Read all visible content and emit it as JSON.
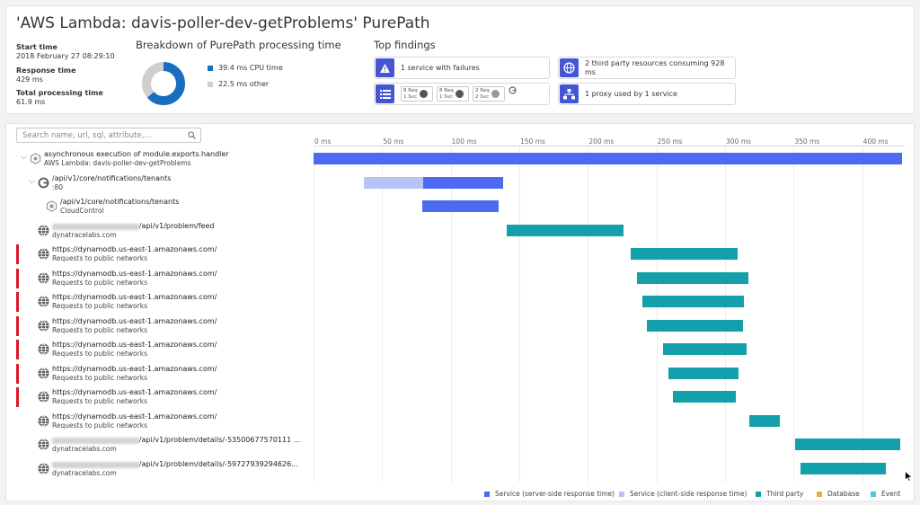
{
  "title": "'AWS Lambda: davis-poller-dev-getProblems' PurePath",
  "summary": [
    {
      "key": "Start time",
      "value": "2018 February 27 08:29:10"
    },
    {
      "key": "Response time",
      "value": "429 ms"
    },
    {
      "key": "Total processing time",
      "value": "61.9 ms"
    }
  ],
  "breakdown": {
    "title": "Breakdown of PurePath processing time",
    "items": [
      {
        "label": "39.4 ms CPU time",
        "color": "#1a6dbf",
        "value": 39.4
      },
      {
        "label": "22.5 ms other",
        "color": "#cfcfcf",
        "value": 22.5
      }
    ]
  },
  "findings": {
    "title": "Top findings",
    "items": [
      {
        "text": "1 service with failures",
        "icon": "warning-icon"
      },
      {
        "text": "2 third party resources consuming 928 ms",
        "icon": "globe-icon"
      },
      {
        "text": "1 proxy used by 1 service",
        "icon": "proxy-icon"
      }
    ],
    "chips": [
      {
        "l1": "8 Req",
        "l2": "1 Svc"
      },
      {
        "l1": "8 Req",
        "l2": "1 Svc"
      },
      {
        "l1": "2 Req",
        "l2": "2 Svc"
      }
    ]
  },
  "search": {
    "placeholder": "Search name, url, sql, attribute,..."
  },
  "axis": {
    "ticks": [
      "0 ms",
      "50 ms",
      "100 ms",
      "150 ms",
      "200 ms",
      "250 ms",
      "300 ms",
      "350 ms",
      "400 ms"
    ],
    "max_ms": 431
  },
  "rows": [
    {
      "l1": "asynchronous execution of module.exports.handler",
      "l2": "AWS Lambda: davis-poller-dev-getProblems",
      "indent": 0,
      "icon": "lambda-icon",
      "expand": true,
      "failed": false,
      "bar": {
        "start": 0,
        "end": 429,
        "kind": "server"
      }
    },
    {
      "l1": "/api/v1/core/notifications/tenants",
      "l2": ":80",
      "indent": 1,
      "icon": "proxy-g-icon",
      "expand": true,
      "failed": false,
      "bar": {
        "start": 37,
        "end": 138,
        "kind": "mixed",
        "split": 80
      }
    },
    {
      "l1": "/api/v1/core/notifications/tenants",
      "l2": "CloudControl",
      "indent": 2,
      "icon": "service-icon",
      "expand": false,
      "failed": false,
      "bar": {
        "start": 79,
        "end": 135,
        "kind": "server"
      }
    },
    {
      "l1pre": "https://davis.dev.dynatrace.com",
      "l1": "/api/v1/problem/feed",
      "l2": "dynatracelabs.com",
      "indent": 1,
      "icon": "globe-icon",
      "expand": false,
      "failed": false,
      "bar": {
        "start": 141,
        "end": 226,
        "kind": "third"
      }
    },
    {
      "l1": "https://dynamodb.us-east-1.amazonaws.com/",
      "l2": "Requests to public networks",
      "indent": 1,
      "icon": "globe-icon",
      "expand": false,
      "failed": true,
      "bar": {
        "start": 231,
        "end": 309,
        "kind": "third"
      }
    },
    {
      "l1": "https://dynamodb.us-east-1.amazonaws.com/",
      "l2": "Requests to public networks",
      "indent": 1,
      "icon": "globe-icon",
      "expand": false,
      "failed": true,
      "bar": {
        "start": 236,
        "end": 317,
        "kind": "third"
      }
    },
    {
      "l1": "https://dynamodb.us-east-1.amazonaws.com/",
      "l2": "Requests to public networks",
      "indent": 1,
      "icon": "globe-icon",
      "expand": false,
      "failed": true,
      "bar": {
        "start": 240,
        "end": 314,
        "kind": "third"
      }
    },
    {
      "l1": "https://dynamodb.us-east-1.amazonaws.com/",
      "l2": "Requests to public networks",
      "indent": 1,
      "icon": "globe-icon",
      "expand": false,
      "failed": true,
      "bar": {
        "start": 243,
        "end": 313,
        "kind": "third"
      }
    },
    {
      "l1": "https://dynamodb.us-east-1.amazonaws.com/",
      "l2": "Requests to public networks",
      "indent": 1,
      "icon": "globe-icon",
      "expand": false,
      "failed": true,
      "bar": {
        "start": 255,
        "end": 316,
        "kind": "third"
      }
    },
    {
      "l1": "https://dynamodb.us-east-1.amazonaws.com/",
      "l2": "Requests to public networks",
      "indent": 1,
      "icon": "globe-icon",
      "expand": false,
      "failed": true,
      "bar": {
        "start": 259,
        "end": 310,
        "kind": "third"
      }
    },
    {
      "l1": "https://dynamodb.us-east-1.amazonaws.com/",
      "l2": "Requests to public networks",
      "indent": 1,
      "icon": "globe-icon",
      "expand": false,
      "failed": true,
      "bar": {
        "start": 262,
        "end": 308,
        "kind": "third"
      }
    },
    {
      "l1": "https://dynamodb.us-east-1.amazonaws.com/",
      "l2": "Requests to public networks",
      "indent": 1,
      "icon": "globe-icon",
      "expand": false,
      "failed": false,
      "bar": {
        "start": 318,
        "end": 340,
        "kind": "third"
      }
    },
    {
      "l1pre": "https://davis.dev.dynatrace.com",
      "l1": "/api/v1/problem/details/-53500677570111 ...",
      "l2": "dynatracelabs.com",
      "indent": 1,
      "icon": "globe-icon",
      "expand": false,
      "failed": false,
      "bar": {
        "start": 351,
        "end": 428,
        "kind": "third"
      }
    },
    {
      "l1pre": "https://davis.dev.dynatrace.com",
      "l1": "/api/v1/problem/details/-59727939294626...",
      "l2": "dynatracelabs.com",
      "indent": 1,
      "icon": "globe-icon",
      "expand": false,
      "failed": false,
      "bar": {
        "start": 355,
        "end": 417,
        "kind": "third"
      }
    }
  ],
  "legend": [
    {
      "label": "Service (server-side response time)",
      "color": "#4d6bf0"
    },
    {
      "label": "Service (client-side response time)",
      "color": "#b8c3f5"
    },
    {
      "label": "Third party",
      "color": "#14a0aa"
    },
    {
      "label": "Database",
      "color": "#e8b32a"
    },
    {
      "label": "Event",
      "color": "#4fc6e0"
    }
  ],
  "colors": {
    "server": "#4d6bf0",
    "client": "#b8c3f5",
    "third": "#14a0aa",
    "fail": "#dc172a",
    "accent": "#4556d4"
  }
}
